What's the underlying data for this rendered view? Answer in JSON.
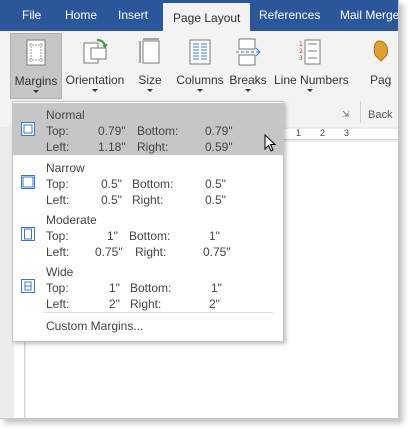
{
  "tabs": [
    "File",
    "Home",
    "Insert",
    "Page Layout",
    "References",
    "Mail Merge"
  ],
  "ribbon": {
    "buttons": [
      "Margins",
      "Orientation",
      "Size",
      "Columns",
      "Breaks",
      "Line Numbers",
      "Pag"
    ],
    "group_label": "Back"
  },
  "ruler": {
    "marks": [
      "1",
      "2",
      "3"
    ]
  },
  "margins_menu": {
    "presets": [
      {
        "name": "Normal",
        "top": "0.79\"",
        "bottom": "0.79\"",
        "left": "1.18\"",
        "right": "0.59\"",
        "selected": true
      },
      {
        "name": "Narrow",
        "top": "0.5\"",
        "bottom": "0.5\"",
        "left": "0.5\"",
        "right": "0.5\""
      },
      {
        "name": "Moderate",
        "top": "1\"",
        "bottom": "1\"",
        "left": "0.75\"",
        "right": "0.75\""
      },
      {
        "name": "Wide",
        "top": "1\"",
        "bottom": "1\"",
        "left": "2\"",
        "right": "2\""
      }
    ],
    "labels": {
      "top": "Top:",
      "bottom": "Bottom:",
      "left": "Left:",
      "right": "Right:"
    },
    "custom": "Custom Margins..."
  },
  "colors": {
    "tabbar": "#2b579a",
    "highlight": "#c6c6c6",
    "icon_blue": "#3c78c8"
  }
}
